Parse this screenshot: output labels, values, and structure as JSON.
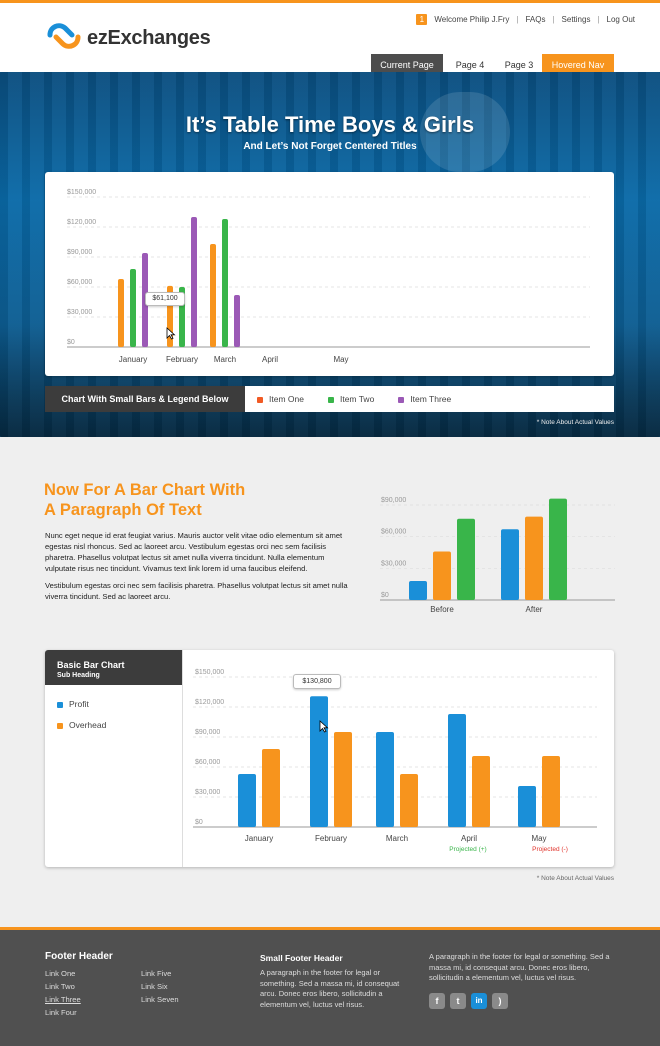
{
  "brand": {
    "name": "ezExchanges",
    "accent": "#f7941d",
    "blue": "#1a8fd8"
  },
  "utility_nav": {
    "badge": "1",
    "welcome": "Welcome Philip J.Fry",
    "faqs": "FAQs",
    "settings": "Settings",
    "logout": "Log Out"
  },
  "main_nav": {
    "current": "Current Page",
    "page4": "Page 4",
    "page3": "Page 3",
    "hovered": "Hovered Nav"
  },
  "hero": {
    "title": "It’s Table Time Boys & Girls",
    "subtitle": "And Let’s Not Forget Centered Titles"
  },
  "chart1": {
    "legend_title": "Chart With Small Bars & Legend Below",
    "tooltip": "$61,100",
    "note": "* Note About Actual Values",
    "yticks": [
      "$150,000",
      "$120,000",
      "$90,000",
      "$60,000",
      "$30,000",
      "$0"
    ],
    "xlabels": [
      "January",
      "February",
      "March",
      "April",
      "May"
    ],
    "legend": [
      "Item One",
      "Item Two",
      "Item Three"
    ]
  },
  "section2": {
    "heading_line1": "Now For A Bar Chart With",
    "heading_line2": "A Paragraph Of Text",
    "para1": "Nunc eget neque id erat feugiat varius. Mauris auctor velit vitae odio elementum sit amet egestas nisl rhoncus. Sed ac laoreet arcu. Vestibulum egestas orci nec sem facilisis pharetra. Phasellus volutpat lectus sit amet nulla viverra tincidunt. Nulla elementum vulputate risus nec tincidunt. Vivamus text link lorem id urna faucibus eleifend.",
    "para2": "Vestibulum egestas orci nec sem facilisis pharetra. Phasellus volutpat lectus sit amet nulla viverra tincidunt. Sed ac laoreet arcu.",
    "yticks": [
      "$90,000",
      "$60,000",
      "$30,000",
      "$0"
    ],
    "xlabels": [
      "Before",
      "After"
    ]
  },
  "chart3": {
    "title": "Basic Bar Chart",
    "subheading": "Sub Heading",
    "legend": [
      "Profit",
      "Overhead"
    ],
    "tooltip": "$130,800",
    "yticks": [
      "$150,000",
      "$120,000",
      "$90,000",
      "$60,000",
      "$30,000",
      "$0"
    ],
    "xlabels": [
      "January",
      "February",
      "March",
      "April",
      "May"
    ],
    "april_note": "Projected (+)",
    "may_note": "Projected (-)",
    "note": "* Note About Actual Values"
  },
  "chart_data": [
    {
      "type": "bar",
      "categories": [
        "January",
        "February",
        "March",
        "April",
        "May"
      ],
      "ylim": [
        0,
        150000
      ],
      "series": [
        {
          "name": "Item One",
          "color": "#f7941d",
          "values": [
            68000,
            61100,
            103000,
            null,
            null
          ]
        },
        {
          "name": "Item Two",
          "color": "#39b54a",
          "values": [
            78000,
            60000,
            128000,
            null,
            null
          ]
        },
        {
          "name": "Item Three",
          "color": "#9b59b6",
          "values": [
            94000,
            130000,
            52000,
            null,
            null
          ]
        }
      ],
      "legend": "below"
    },
    {
      "type": "bar",
      "categories": [
        "Before",
        "After"
      ],
      "ylim": [
        0,
        90000
      ],
      "series": [
        {
          "color": "#1a8fd8",
          "values": [
            18000,
            67000
          ]
        },
        {
          "color": "#f7941d",
          "values": [
            46000,
            79000
          ]
        },
        {
          "color": "#39b54a",
          "values": [
            77000,
            96000
          ]
        }
      ]
    },
    {
      "type": "bar",
      "categories": [
        "January",
        "February",
        "March",
        "April",
        "May"
      ],
      "ylim": [
        0,
        150000
      ],
      "series": [
        {
          "name": "Profit",
          "color": "#1a8fd8",
          "values": [
            53000,
            130800,
            95000,
            113000,
            41000
          ]
        },
        {
          "name": "Overhead",
          "color": "#f7941d",
          "values": [
            78000,
            95000,
            53000,
            71000,
            71000
          ]
        }
      ],
      "legend": "left"
    }
  ],
  "footer": {
    "header": "Footer Header",
    "links_col1": [
      "Link One",
      "Link Two",
      "Link Three",
      "Link Four"
    ],
    "links_col2": [
      "Link Five",
      "Link Six",
      "Link Seven"
    ],
    "small_header": "Small Footer Header",
    "small_text": "A paragraph in the footer for legal or something. Sed a massa mi, id consequat arcu. Donec eros libero, sollicitudin a elementum vel, luctus vel risus.",
    "right_text": "A paragraph in the footer for legal or something. Sed a massa mi, id consequat arcu. Donec eros libero, sollicitudin a elementum vel, luctus vel risus.",
    "social": [
      {
        "icon": "facebook-icon",
        "glyph": "f"
      },
      {
        "icon": "twitter-icon",
        "glyph": "t"
      },
      {
        "icon": "linkedin-icon",
        "glyph": "in"
      },
      {
        "icon": "rss-icon",
        "glyph": ")"
      }
    ]
  }
}
